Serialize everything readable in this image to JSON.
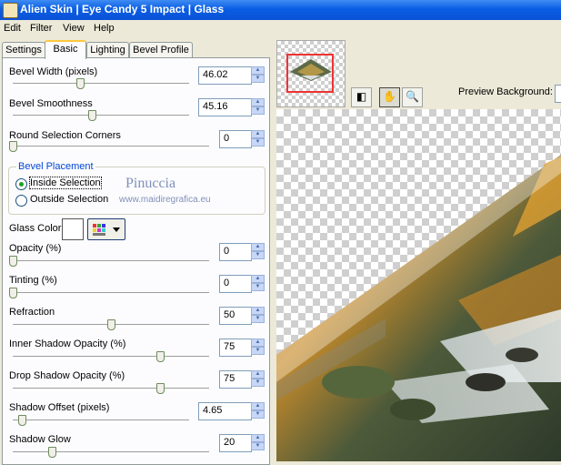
{
  "window": {
    "title": "Alien Skin | Eye Candy 5 Impact | Glass"
  },
  "menu": [
    "Edit",
    "Filter",
    "View",
    "Help"
  ],
  "tabs": [
    "Settings",
    "Basic",
    "Lighting",
    "Bevel Profile"
  ],
  "active_tab": "Basic",
  "controls": {
    "bevel_width": {
      "label": "Bevel Width (pixels)",
      "value": "46.02",
      "level": 0.38
    },
    "bevel_smoothness": {
      "label": "Bevel Smoothness",
      "value": "45.16",
      "level": 0.45
    },
    "round_corners": {
      "label": "Round Selection Corners",
      "value": "0",
      "level": 0
    },
    "opacity": {
      "label": "Opacity (%)",
      "value": "0",
      "level": 0
    },
    "tinting": {
      "label": "Tinting (%)",
      "value": "0",
      "level": 0
    },
    "refraction": {
      "label": "Refraction",
      "value": "50",
      "level": 0.5
    },
    "inner_shadow": {
      "label": "Inner Shadow Opacity (%)",
      "value": "75",
      "level": 0.75
    },
    "drop_shadow": {
      "label": "Drop Shadow Opacity (%)",
      "value": "75",
      "level": 0.75
    },
    "shadow_offset": {
      "label": "Shadow Offset (pixels)",
      "value": "4.65",
      "level": 0.05
    },
    "shadow_glow": {
      "label": "Shadow Glow",
      "value": "20",
      "level": 0.2
    }
  },
  "bevel_placement": {
    "title": "Bevel Placement",
    "inside": "Inside Selection",
    "outside": "Outside Selection",
    "selected": "inside"
  },
  "glass_color": {
    "label": "Glass Color",
    "color": "#ffffff"
  },
  "watermark": {
    "name": "Pinuccia",
    "site": "www.maidiregrafica.eu"
  },
  "preview": {
    "background_label": "Preview Background:"
  },
  "icons": [
    "eye-candy-app-icon",
    "preview-toggle-icon",
    "hand-pan-icon",
    "magnifier-zoom-icon",
    "color-palette-icon",
    "dropdown-arrow-icon"
  ]
}
